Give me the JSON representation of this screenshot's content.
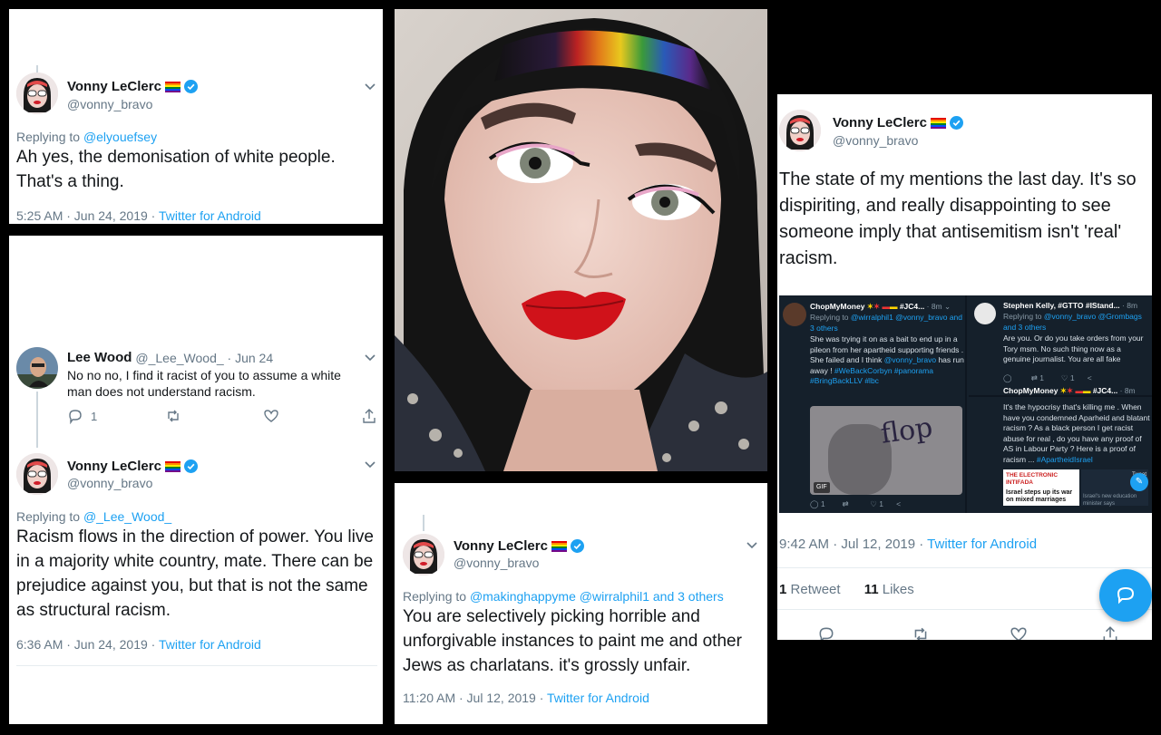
{
  "tweet1": {
    "name": "Vonny LeClerc",
    "handle": "@vonny_bravo",
    "reply_prefix": "Replying to",
    "reply_to": "@elyouefsey",
    "text": "Ah yes, the demonisation of white people. That's a thing.",
    "time": "5:25 AM · Jun 24, 2019 · ",
    "source": "Twitter for Android"
  },
  "tweet2": {
    "parent": {
      "name": "Lee Wood",
      "handle": "@_Lee_Wood_ · Jun 24",
      "text": "No no no, I find it racist of you to assume a white man does not understand racism.",
      "reply_count": "1"
    },
    "name": "Vonny LeClerc",
    "handle": "@vonny_bravo",
    "reply_prefix": "Replying to",
    "reply_to": "@_Lee_Wood_",
    "text": "Racism flows in the direction of power. You live in a majority white country, mate. There can be prejudice against you, but that is not the same as structural racism.",
    "time": "6:36 AM · Jun 24, 2019 · ",
    "source": "Twitter for Android"
  },
  "tweet3": {
    "name": "Vonny LeClerc",
    "handle": "@vonny_bravo",
    "reply_prefix": "Replying to",
    "reply_to": "@makinghappyme @wirralphil1 and 3 others",
    "text": "You are selectively picking horrible and unforgivable instances to paint me and other Jews as charlatans. it's grossly unfair.",
    "time": "11:20 AM · Jul 12, 2019 · ",
    "source": "Twitter for Android"
  },
  "tweet4": {
    "name": "Vonny LeClerc",
    "handle": "@vonny_bravo",
    "text": "The state of my mentions the last day. It's so dispiriting, and really disappointing to see someone imply that antisemitism isn't 'real' racism.",
    "time": "9:42 AM · Jul 12, 2019 · ",
    "source": "Twitter for Android",
    "retweets_count": "1",
    "retweets_label": "Retweet",
    "likes_count": "11",
    "likes_label": "Likes",
    "embedded": {
      "left": {
        "name": "ChopMyMoney",
        "tag": "#JC4...",
        "time": "8m",
        "reply_prefix": "Replying to",
        "reply_to": "@wirralphil1 @vonny_bravo and 3 others",
        "body": "She was trying it on as a bait to end up in a pileon from her apartheid supporting friends . She failed and I think",
        "body_handle": "@vonny_bravo",
        "body_tail": "has run away !",
        "hashtags": "#WeBackCorbyn #panorama #BringBackLLV #lbc",
        "gif_text": "flop",
        "gif_badge": "GIF"
      },
      "right_top": {
        "name": "Stephen Kelly, #GTTO #IStand...",
        "time": "8m",
        "reply_prefix": "Replying to",
        "reply_to": "@vonny_bravo @Grombags and 3 others",
        "body": "Are you. Or do you take orders from your Tory msm. No such thing now as a genuine journalist. You are all fake"
      },
      "right_bottom": {
        "name": "ChopMyMoney",
        "tag": "#JC4...",
        "time": "8m",
        "body": "It's the hypocrisy that's killing me . When have you condemned Aparheid and blatant racism ? As a black person I get racist abuse for real , do you have any proof of AS in Labour Party ? Here is a proof of racism ...",
        "hashtag": "#ApartheidIsrael",
        "card_source": "THE ELECTRONIC INTIFADA",
        "card_title": "Israel steps up its war on mixed marriages",
        "card_sub": "Israel's new education minister says",
        "card_tweet": "Tweet"
      }
    }
  },
  "colors": {
    "link": "#1da1f2",
    "muted": "#657786",
    "text": "#14171a",
    "dark_panel": "#15202b"
  }
}
